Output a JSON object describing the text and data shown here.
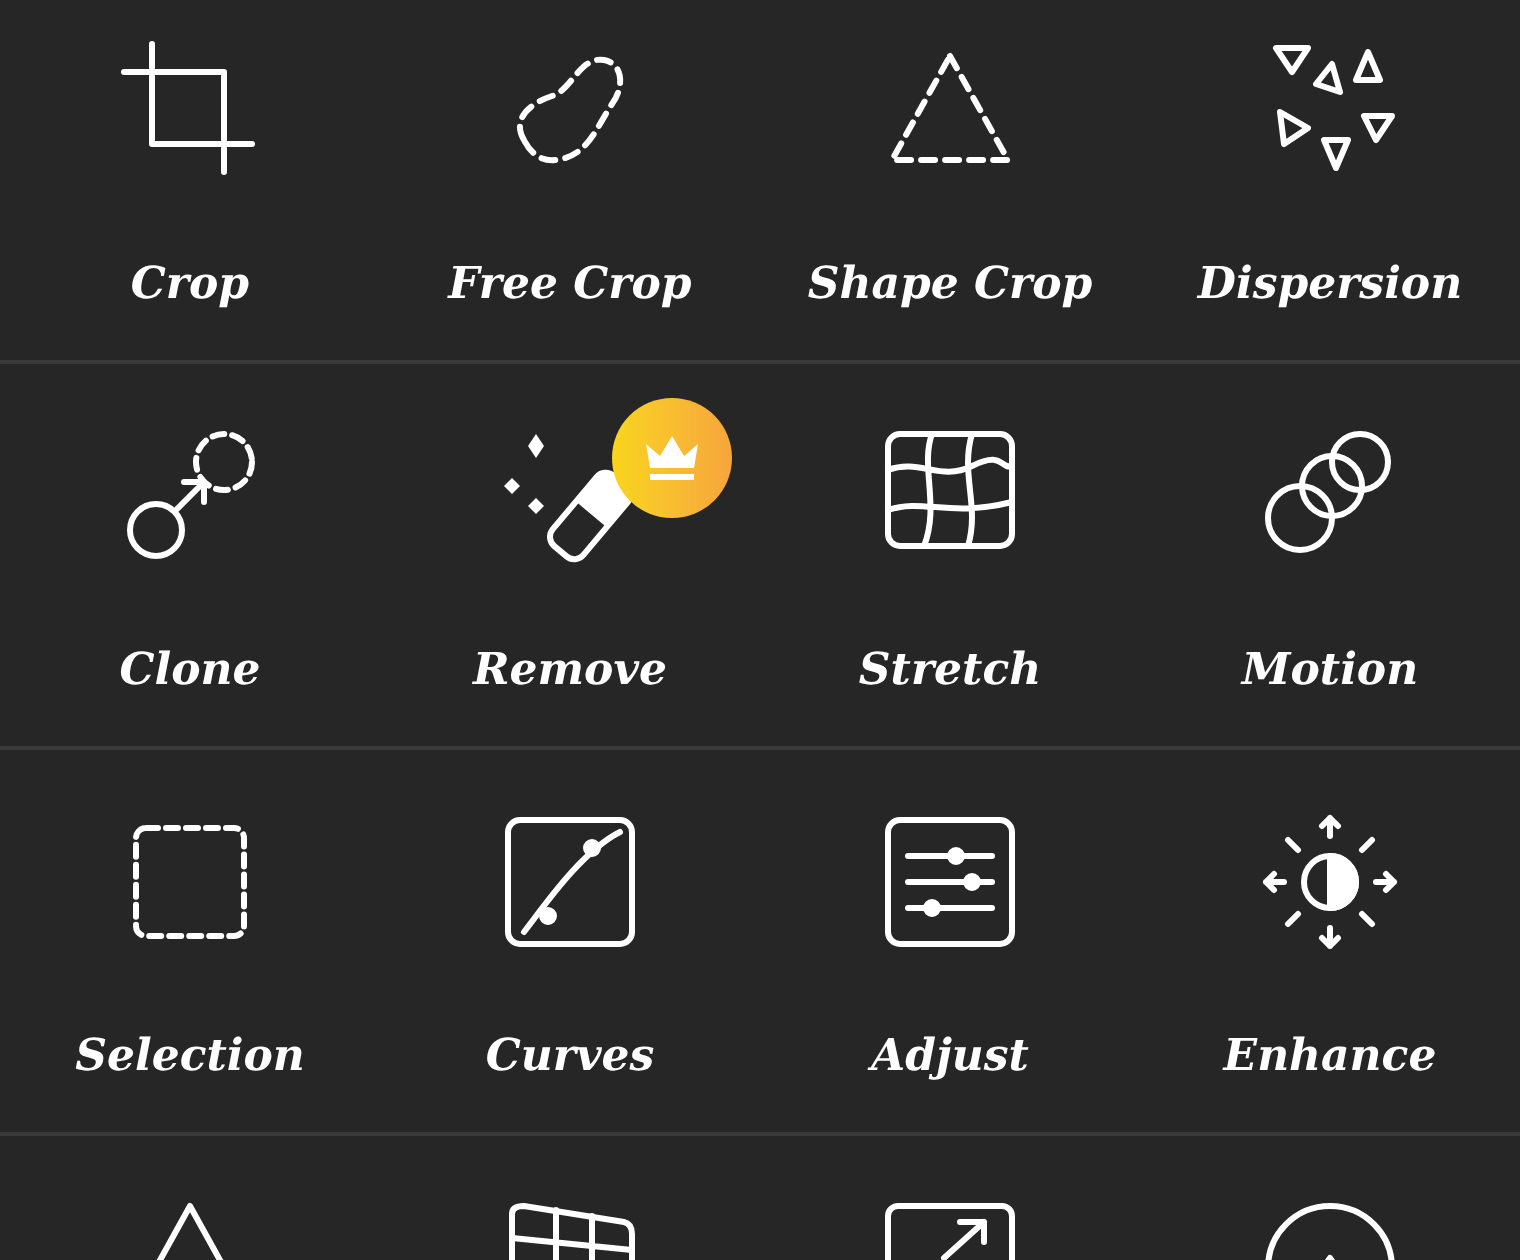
{
  "tools": [
    {
      "label": "Crop",
      "premium": false
    },
    {
      "label": "Free Crop",
      "premium": false
    },
    {
      "label": "Shape Crop",
      "premium": false
    },
    {
      "label": "Dispersion",
      "premium": false
    },
    {
      "label": "Clone",
      "premium": false
    },
    {
      "label": "Remove",
      "premium": true
    },
    {
      "label": "Stretch",
      "premium": false
    },
    {
      "label": "Motion",
      "premium": false
    },
    {
      "label": "Selection",
      "premium": false
    },
    {
      "label": "Curves",
      "premium": false
    },
    {
      "label": "Adjust",
      "premium": false
    },
    {
      "label": "Enhance",
      "premium": false
    }
  ]
}
